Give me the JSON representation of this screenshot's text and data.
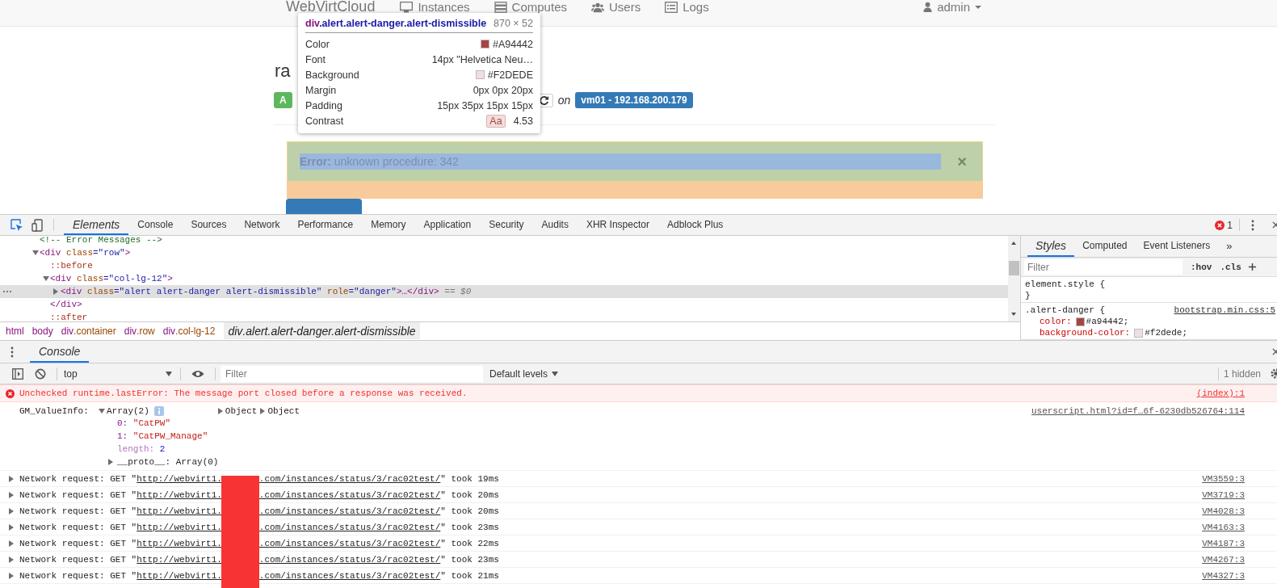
{
  "navbar": {
    "brand": "WebVirtCloud",
    "links": [
      {
        "label": "Instances"
      },
      {
        "label": "Computes"
      },
      {
        "label": "Users"
      },
      {
        "label": "Logs"
      }
    ],
    "user": "admin"
  },
  "instance": {
    "title": "ra",
    "status_badge": "A",
    "on_label": "on",
    "host_badge": "vm01 - 192.168.200.179"
  },
  "alert": {
    "message": "**Error:** unknown procedure: 342",
    "close": "×"
  },
  "inspect_tooltip": {
    "tag": "div",
    "classes": ".alert.alert-danger.alert-dismissible",
    "size": "870 × 52",
    "rows": [
      {
        "label": "Color",
        "value": "#A94442",
        "color": "#a94442"
      },
      {
        "label": "Font",
        "value": "14px \"Helvetica Neu…"
      },
      {
        "label": "Background",
        "value": "#F2DEDE",
        "color": "#f2dede"
      },
      {
        "label": "Margin",
        "value": "0px 0px 20px"
      },
      {
        "label": "Padding",
        "value": "15px 35px 15px 15px"
      },
      {
        "label": "Contrast",
        "badge": "Aa",
        "value": "4.53"
      }
    ]
  },
  "devtools": {
    "tabs": [
      {
        "label": "Elements",
        "selected": true
      },
      {
        "label": "Console",
        "selected": false
      },
      {
        "label": "Sources",
        "selected": false
      },
      {
        "label": "Network",
        "selected": false
      },
      {
        "label": "Performance",
        "selected": false
      },
      {
        "label": "Memory",
        "selected": false
      },
      {
        "label": "Application",
        "selected": false
      },
      {
        "label": "Security",
        "selected": false
      },
      {
        "label": "Audits",
        "selected": false
      },
      {
        "label": "XHR Inspector",
        "selected": false
      },
      {
        "label": "Adblock Plus",
        "selected": false
      }
    ],
    "error_count": "1",
    "elements_tree": [
      {
        "kind": "comment",
        "tokens": [
          {
            "kind": "comment",
            "text": "<!-- Error Messages -->"
          }
        ]
      },
      {
        "kind": "element",
        "expanded": true,
        "selected": false,
        "tokens": [
          {
            "kind": "tag",
            "text": "<div"
          },
          {
            "kind": "attr-name",
            "text": " class"
          },
          {
            "kind": "attr-value",
            "text": "=\"row\""
          },
          {
            "kind": "tag",
            "text": ">"
          }
        ],
        "children": [
          {
            "kind": "pseudo",
            "tokens": [
              {
                "kind": "pseudo",
                "text": "::before"
              }
            ]
          },
          {
            "kind": "element",
            "expanded": true,
            "selected": false,
            "tokens": [
              {
                "kind": "tag",
                "text": "<div"
              },
              {
                "kind": "attr-name",
                "text": " class"
              },
              {
                "kind": "attr-value",
                "text": "=\"col-lg-12\""
              },
              {
                "kind": "tag",
                "text": ">"
              }
            ],
            "children": [
              {
                "kind": "element",
                "expanded": false,
                "selected": true,
                "tokens": [
                  {
                    "kind": "tag",
                    "text": "<div"
                  },
                  {
                    "kind": "attr-name",
                    "text": " class"
                  },
                  {
                    "kind": "attr-value",
                    "text": "=\"alert alert-danger alert-dismissible\""
                  },
                  {
                    "kind": "attr-name",
                    "text": " role"
                  },
                  {
                    "kind": "attr-value",
                    "text": "=\"danger\""
                  },
                  {
                    "kind": "tag",
                    "text": ">…</div>"
                  },
                  {
                    "kind": "marker",
                    "text": " == $0"
                  }
                ]
              }
            ]
          },
          {
            "kind": "close",
            "tokens": [
              {
                "kind": "tag",
                "text": "</div>"
              }
            ]
          },
          {
            "kind": "pseudo",
            "tokens": [
              {
                "kind": "pseudo",
                "text": "::after"
              }
            ]
          }
        ]
      }
    ],
    "breadcrumbs": [
      {
        "tag": "html",
        "selected": false
      },
      {
        "tag": "body",
        "selected": false
      },
      {
        "tag": "div",
        "classes": ".container",
        "selected": false
      },
      {
        "tag": "div",
        "classes": ".row",
        "selected": false
      },
      {
        "tag": "div",
        "classes": ".col-lg-12",
        "selected": false
      },
      {
        "tag": "div",
        "classes": ".alert.alert-danger.alert-dismissible",
        "selected": true
      }
    ],
    "styles": {
      "tabs": [
        {
          "label": "Styles",
          "selected": true
        },
        {
          "label": "Computed",
          "selected": false
        },
        {
          "label": "Event Listeners",
          "selected": false
        }
      ],
      "overflow": "»",
      "filter_placeholder": "Filter",
      "hov": ":hov",
      "cls": ".cls",
      "rules": [
        {
          "selector": "element.style {",
          "close": "}"
        },
        {
          "selector": ".alert-danger {",
          "source": "bootstrap.min.css:5",
          "properties": [
            {
              "name": "color:",
              "value": "#a94442;",
              "color": "#a94442"
            },
            {
              "name": "background-color:",
              "value": "#f2dede;",
              "color": "#f2dede"
            }
          ]
        }
      ]
    },
    "drawer_tab": "Console",
    "console": {
      "context": "top",
      "filter_placeholder": "Filter",
      "levels": "Default levels",
      "hidden_count": "1 hidden",
      "messages": [
        {
          "kind": "error",
          "text": "Unchecked runtime.lastError: The message port closed before a response was received.",
          "source": "(index):1"
        },
        {
          "kind": "object",
          "label": "GM_ValueInfo:",
          "summary": "Array(2)",
          "expanded": true,
          "previews": [
            "Object",
            "Object"
          ],
          "source": "userscript.html?id=f…6f-6230db526764:114",
          "entries": [
            {
              "key": "0:",
              "value": "\"CatPW\"",
              "kind": "string"
            },
            {
              "key": "1:",
              "value": "\"CatPW_Manage\"",
              "kind": "string"
            },
            {
              "key": "length:",
              "value": "2",
              "kind": "number"
            },
            {
              "key": "__proto__:",
              "value": "Array(0)",
              "kind": "object"
            }
          ]
        },
        {
          "kind": "network",
          "text": "Network request: GET \"",
          "url_start": "http://webvirt1.",
          "url_end": ".com/instances/status/3/rac02test/",
          "tail": "\" took 19ms",
          "source": "VM3559:3"
        },
        {
          "kind": "network",
          "text": "Network request: GET \"",
          "url_start": "http://webvirt1.",
          "url_end": ".com/instances/status/3/rac02test/",
          "tail": "\" took 20ms",
          "source": "VM3719:3"
        },
        {
          "kind": "network",
          "text": "Network request: GET \"",
          "url_start": "http://webvirt1.",
          "url_end": ".com/instances/status/3/rac02test/",
          "tail": "\" took 20ms",
          "source": "VM4028:3"
        },
        {
          "kind": "network",
          "text": "Network request: GET \"",
          "url_start": "http://webvirt1.",
          "url_end": ".com/instances/status/3/rac02test/",
          "tail": "\" took 23ms",
          "source": "VM4163:3"
        },
        {
          "kind": "network",
          "text": "Network request: GET \"",
          "url_start": "http://webvirt1.",
          "url_end": ".com/instances/status/3/rac02test/",
          "tail": "\" took 22ms",
          "source": "VM4187:3"
        },
        {
          "kind": "network",
          "text": "Network request: GET \"",
          "url_start": "http://webvirt1.",
          "url_end": ".com/instances/status/3/rac02test/",
          "tail": "\" took 23ms",
          "source": "VM4267:3"
        },
        {
          "kind": "network",
          "text": "Network request: GET \"",
          "url_start": "http://webvirt1.",
          "url_end": ".com/instances/status/3/rac02test/",
          "tail": "\" took 21ms",
          "source": "VM4327:3"
        }
      ]
    }
  }
}
